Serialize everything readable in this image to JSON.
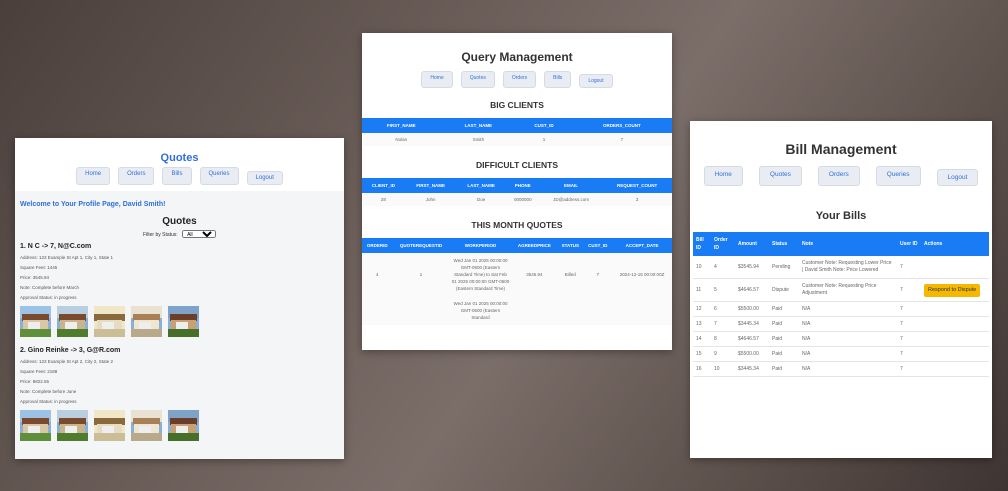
{
  "left": {
    "title": "Quotes",
    "nav": [
      "Home",
      "Orders",
      "Bills",
      "Queries",
      "Logout"
    ],
    "welcome": "Welcome to Your Profile Page, David Smith!",
    "heading": "Quotes",
    "filter_label": "Filter by Status:",
    "filter_value": "All",
    "quotes": [
      {
        "title": "1. N C -> 7, N@C.com",
        "address": "Address: 123 Example St Apt 1, City 1, State 1",
        "sqft": "Square Feet: 1445",
        "price": "Price: 3545.94",
        "note": "Note: Complete before March",
        "status": "Approval Status: in progress"
      },
      {
        "title": "2. Gino Reinke -> 3, G@R.com",
        "address": "Address: 123 Example St Apt 2, City 2, State 2",
        "sqft": "Square Feet: 2188",
        "price": "Price: 8822.55",
        "note": "Note: Complete before June",
        "status": "Approval Status: in progress"
      }
    ]
  },
  "middle": {
    "title": "Query Management",
    "nav": [
      "Home",
      "Quotes",
      "Orders",
      "Bills",
      "Logout"
    ],
    "big_clients": {
      "heading": "BIG CLIENTS",
      "columns": [
        "FIRST_NAME",
        "LAST_NAME",
        "CUST_ID",
        "ORDERS_COUNT"
      ],
      "rows": [
        [
          "Nolan",
          "Smith",
          "1",
          "7"
        ]
      ]
    },
    "difficult_clients": {
      "heading": "DIFFICULT CLIENTS",
      "columns": [
        "CLIENT_ID",
        "FIRST_NAME",
        "LAST_NAME",
        "PHONE",
        "EMAIL",
        "REQUEST_COUNT"
      ],
      "rows": [
        [
          "28",
          "John",
          "Doe",
          "0000000",
          "JD@address.com",
          "3"
        ]
      ]
    },
    "month_quotes": {
      "heading": "THIS MONTH QUOTES",
      "columns": [
        "ORDERID",
        "QUOTEREQUESTID",
        "WORKPERIOD",
        "AGREEDPRICE",
        "STATUS",
        "CUST_ID",
        "ACCEPT_DATE"
      ],
      "rows": [
        [
          "4",
          "1",
          "Wed Jan 01 2025 00:00:00 GMT-0500 (Eastern Standard Time) to Sat Feb 01 2025 00:00:00 GMT-0500 (Eastern Standard Time)",
          "3545.94",
          "Billed",
          "7",
          "2024-12-15 00:00:00Z"
        ]
      ],
      "overflow": "Wed Jan 01 2025 00:00:00 GMT-0500 (Eastern Standard"
    }
  },
  "right": {
    "title": "Bill Management",
    "nav": [
      "Home",
      "Quotes",
      "Orders",
      "Queries",
      "Logout"
    ],
    "heading": "Your Bills",
    "columns": [
      "Bill ID",
      "Order ID",
      "Amount",
      "Status",
      "Note",
      "User ID",
      "Actions"
    ],
    "rows": [
      [
        "10",
        "4",
        "$3545.94",
        "Pending",
        "Customer Note: Requesting Lower Price | David Smith Note: Price Lowered",
        "7",
        ""
      ],
      [
        "11",
        "5",
        "$4646.57",
        "Dispute",
        "Customer Note: Requesting Price Adjustment",
        "7",
        "Respond to Dispute"
      ],
      [
        "12",
        "6",
        "$5500.00",
        "Paid",
        "N/A",
        "7",
        ""
      ],
      [
        "13",
        "7",
        "$3445.34",
        "Paid",
        "N/A",
        "7",
        ""
      ],
      [
        "14",
        "8",
        "$4646.57",
        "Paid",
        "N/A",
        "7",
        ""
      ],
      [
        "15",
        "9",
        "$5500.00",
        "Paid",
        "N/A",
        "7",
        ""
      ],
      [
        "16",
        "10",
        "$3445.34",
        "Paid",
        "N/A",
        "7",
        ""
      ]
    ]
  },
  "colors": {
    "accent": "#1a7cf5",
    "link": "#2f6fdd",
    "warning": "#f5b800"
  }
}
